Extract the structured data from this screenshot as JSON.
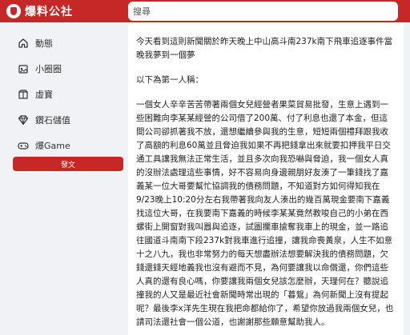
{
  "header": {
    "logo_text": "爆料公社",
    "search_placeholder": "搜尋"
  },
  "sidebar": {
    "items": [
      {
        "label": "動態",
        "icon": "home-icon"
      },
      {
        "label": "小圈圈",
        "icon": "group-icon"
      },
      {
        "label": "虛寶",
        "icon": "package-icon"
      },
      {
        "label": "鑽石儲值",
        "icon": "diamond-icon"
      },
      {
        "label": "爆Game",
        "icon": "gamepad-icon"
      }
    ],
    "post_button": "發文"
  },
  "post": {
    "paragraphs": [
      "今天看到這則新聞關於昨天晚上中山高斗南237k南下飛車追逐事件當晚我夢到一個夢",
      "以下為第一人稱：",
      "一個女人辛辛苦苦帶著兩個女兒經營者果菜貿易批發，生意上遇到一些困難向李某某經營的公司借了200萬、付了利息也還了本金，但這間公司卻抓著我不放，還想繼續參與我的生意，短短兩個禮拜跟我收了高額的利息60萬並且脅迫我如果不再把錢拿出來就要扣押我平日交通工具讓我無法正常生活，並且多次向我恐嚇與脅迫，我一個女人真的沒辦法處理這些事情，好不容易向身邊親朋好友湊了一筆錢找了嘉義某一位大哥要幫忙協調我的債務問題，不知道對方如何得知我在9/23晚上10:20分左右我帶著我向友人湊出的幾百萬現金要南下嘉義找這位大哥，在我要南下嘉義的時候李某某竟然教唆自己的小弟在西螺街上開窗對我叫囂與追逐，試圖攔車搶奪我車上的現金，並一路追往國道斗南南下段237k對我車進行追撞，讓我命喪黃泉，人生不如意十之八九，我也非常努力的每天想盡辦法想要解決我的債務問題，欠錢還錢天經地義我也沒有避而不見，為何要讓我以命償還，你們這些人真的還有良心嗎，你要讓我兩個女兒該怎麼辦，天理何在？聽說追撞我的人又是最近社會新聞時常出現的「暮鴛」為何新聞上沒有提起呢？最後李x洋先生現在我把命都給你了，希望你放過我兩個女兒，也請司法還社會一個公道，也謝謝那些願意幫助我人。"
    ]
  }
}
